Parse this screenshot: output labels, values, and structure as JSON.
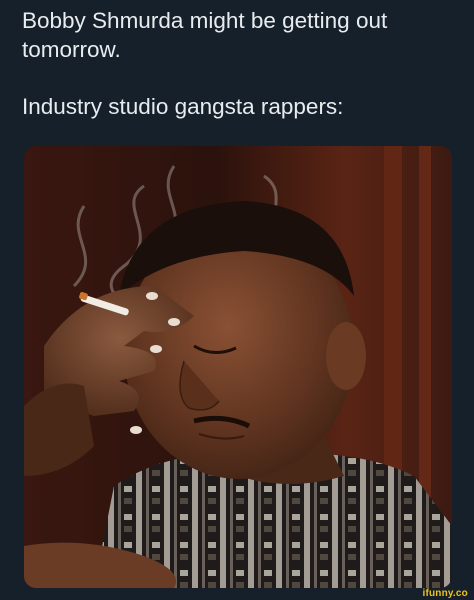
{
  "caption": {
    "line1": "Bobby Shmurda might be getting out tomorrow.",
    "line2": "Industry studio gangsta rappers:"
  },
  "photo": {
    "subject": "man smoking a cigarette with hand on forehead, eyes closed"
  },
  "watermark": "ifunny.co"
}
